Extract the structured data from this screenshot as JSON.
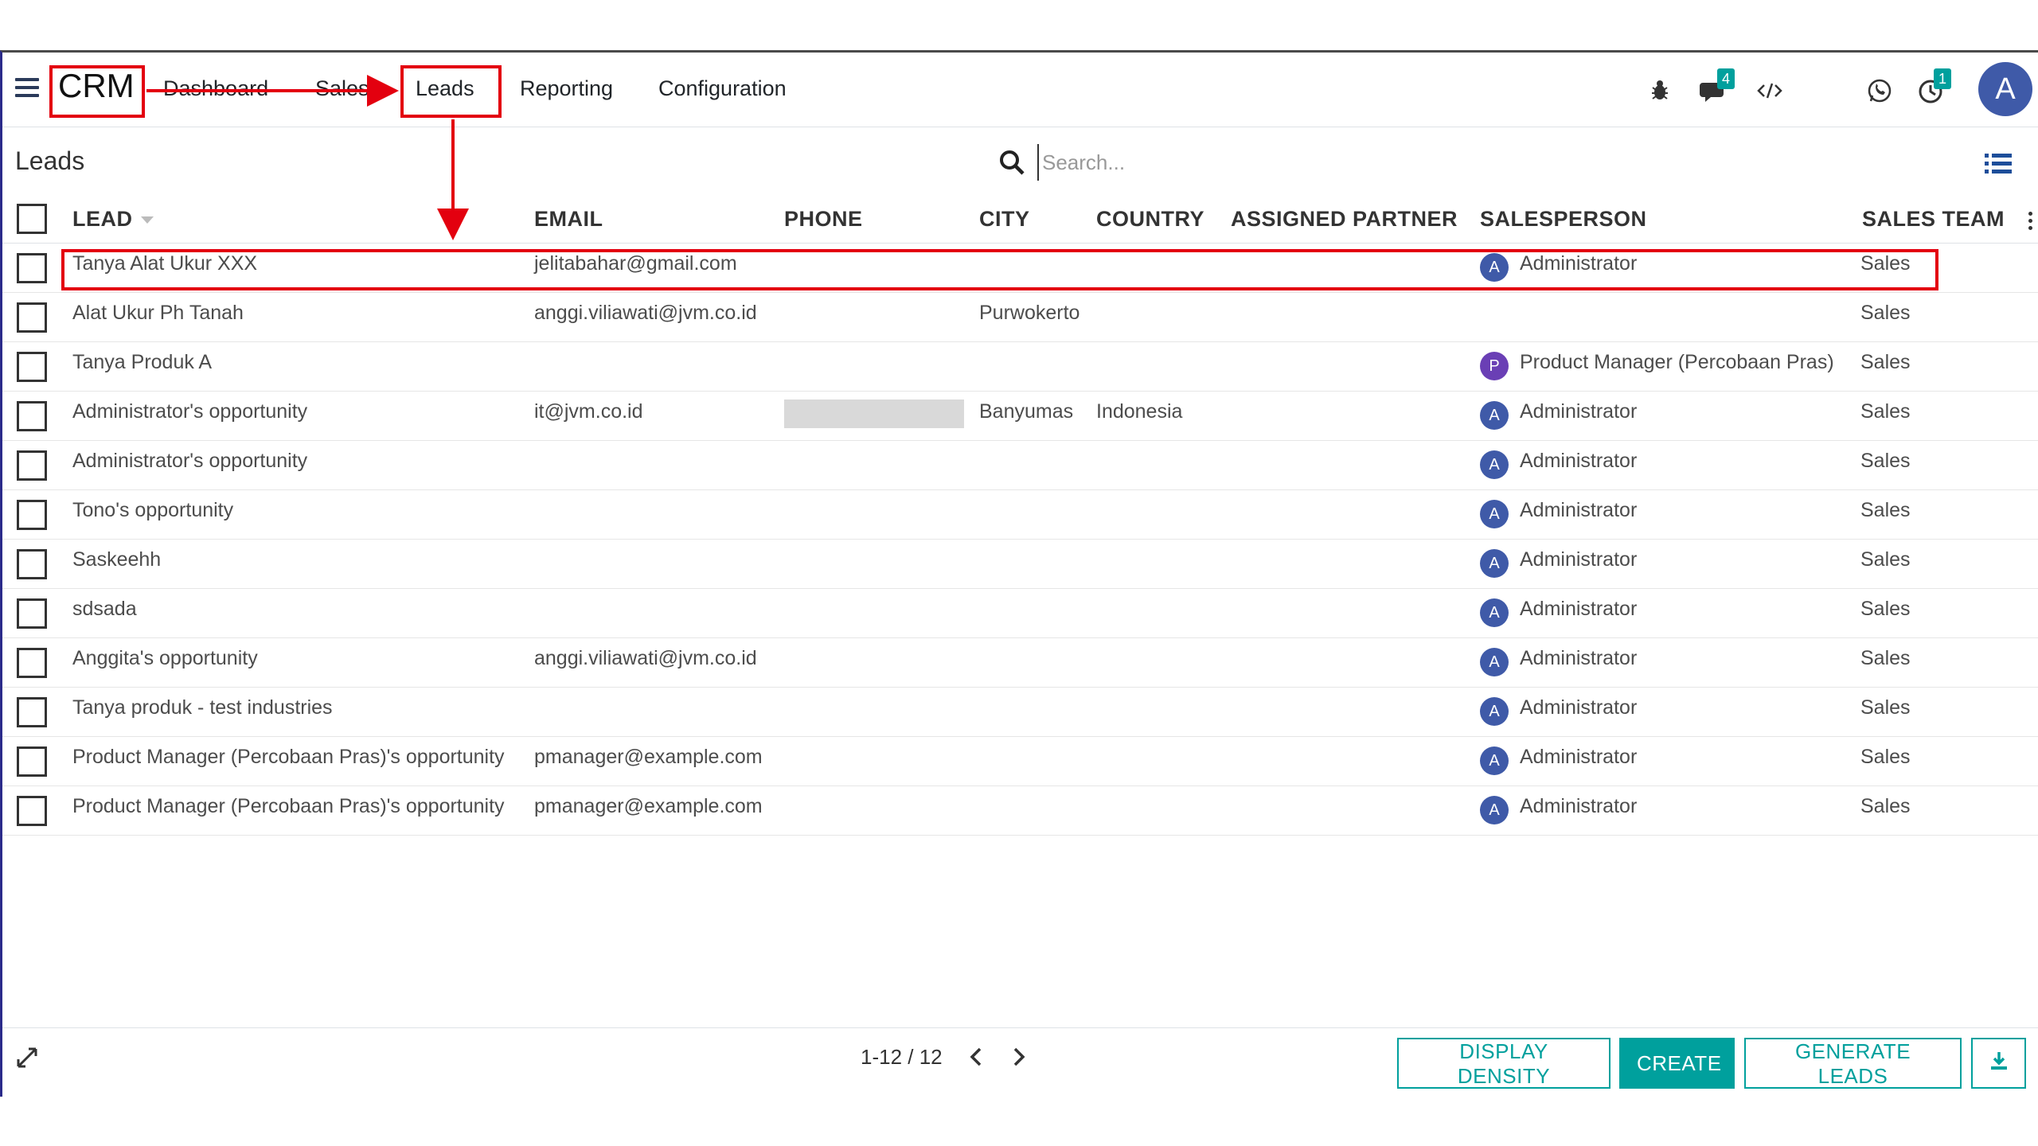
{
  "app": {
    "brand": "CRM",
    "nav": [
      {
        "label": "Dashboard"
      },
      {
        "label": "Sales"
      },
      {
        "label": "Leads"
      },
      {
        "label": "Reporting"
      },
      {
        "label": "Configuration"
      }
    ],
    "badges": {
      "messages": "4",
      "activities": "1"
    },
    "user_initial": "A"
  },
  "page": {
    "title": "Leads",
    "search_placeholder": "Search..."
  },
  "table": {
    "columns": [
      "LEAD",
      "EMAIL",
      "PHONE",
      "CITY",
      "COUNTRY",
      "ASSIGNED PARTNER",
      "SALESPERSON",
      "SALES TEAM"
    ],
    "rows": [
      {
        "lead": "Tanya Alat Ukur XXX",
        "email": "jelitabahar@gmail.com",
        "phone": "",
        "city": "",
        "country": "",
        "sp_initial": "A",
        "salesperson": "Administrator",
        "team": "Sales"
      },
      {
        "lead": "Alat Ukur Ph Tanah",
        "email": "anggi.viliawati@jvm.co.id",
        "phone": "",
        "city": "Purwokerto",
        "country": "",
        "sp_initial": "",
        "salesperson": "",
        "team": "Sales"
      },
      {
        "lead": "Tanya Produk A",
        "email": "",
        "phone": "",
        "city": "",
        "country": "",
        "sp_initial": "P",
        "salesperson": "Product Manager (Percobaan Pras)",
        "team": "Sales"
      },
      {
        "lead": "Administrator's opportunity",
        "email": "it@jvm.co.id",
        "phone": "",
        "city": "Banyumas",
        "country": "Indonesia",
        "sp_initial": "A",
        "salesperson": "Administrator",
        "team": "Sales"
      },
      {
        "lead": "Administrator's opportunity",
        "email": "",
        "phone": "",
        "city": "",
        "country": "",
        "sp_initial": "A",
        "salesperson": "Administrator",
        "team": "Sales"
      },
      {
        "lead": "Tono's opportunity",
        "email": "",
        "phone": "",
        "city": "",
        "country": "",
        "sp_initial": "A",
        "salesperson": "Administrator",
        "team": "Sales"
      },
      {
        "lead": "Saskeehh",
        "email": "",
        "phone": "",
        "city": "",
        "country": "",
        "sp_initial": "A",
        "salesperson": "Administrator",
        "team": "Sales"
      },
      {
        "lead": "sdsada",
        "email": "",
        "phone": "",
        "city": "",
        "country": "",
        "sp_initial": "A",
        "salesperson": "Administrator",
        "team": "Sales"
      },
      {
        "lead": "Anggita's opportunity",
        "email": "anggi.viliawati@jvm.co.id",
        "phone": "",
        "city": "",
        "country": "",
        "sp_initial": "A",
        "salesperson": "Administrator",
        "team": "Sales"
      },
      {
        "lead": "Tanya produk - test industries",
        "email": "",
        "phone": "",
        "city": "",
        "country": "",
        "sp_initial": "A",
        "salesperson": "Administrator",
        "team": "Sales"
      },
      {
        "lead": "Product Manager (Percobaan Pras)'s opportunity",
        "email": "pmanager@example.com",
        "phone": "",
        "city": "",
        "country": "",
        "sp_initial": "A",
        "salesperson": "Administrator",
        "team": "Sales"
      },
      {
        "lead": "Product Manager (Percobaan Pras)'s opportunity",
        "email": "pmanager@example.com",
        "phone": "",
        "city": "",
        "country": "",
        "sp_initial": "A",
        "salesperson": "Administrator",
        "team": "Sales"
      }
    ]
  },
  "footer": {
    "pager": "1-12 / 12",
    "buttons": {
      "density": "DISPLAY DENSITY",
      "create": "CREATE",
      "generate": "GENERATE LEADS"
    }
  },
  "colors": {
    "accent": "#00a09d",
    "annotation": "#e3000f",
    "avatar_admin": "#3f5aa8",
    "avatar_pm": "#6a3fb5"
  }
}
